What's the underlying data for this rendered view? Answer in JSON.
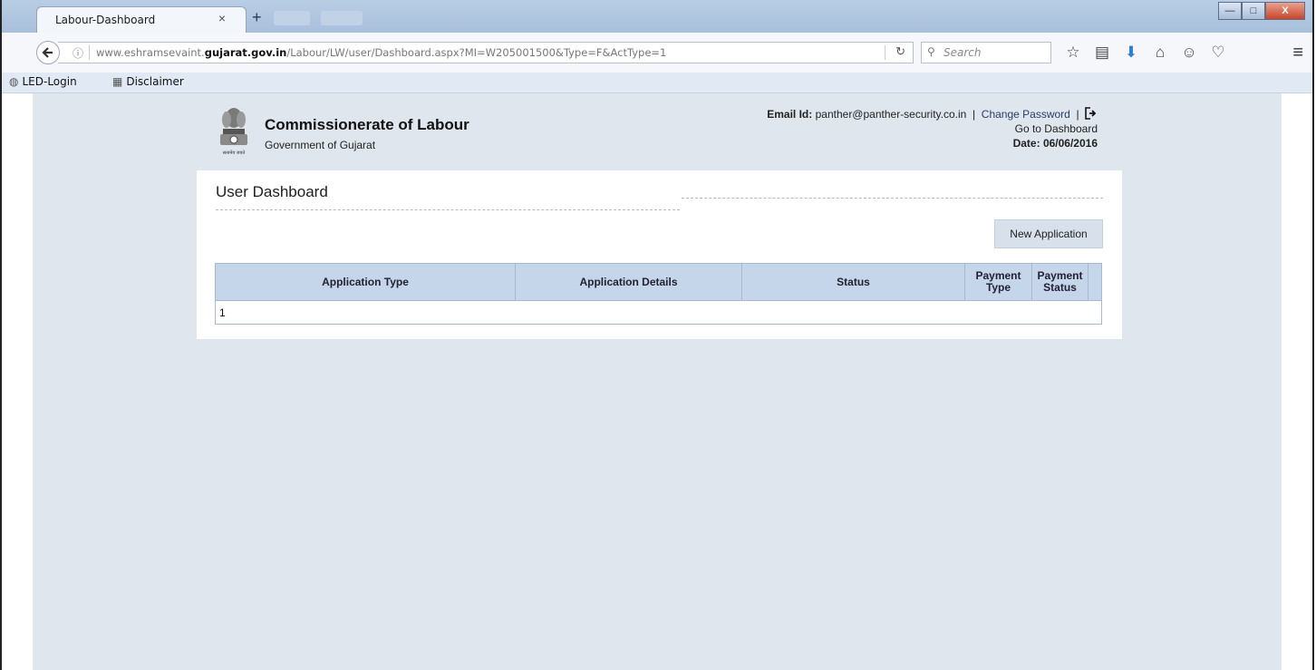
{
  "browser": {
    "tab_title": "Labour-Dashboard",
    "tab_close": "×",
    "new_tab": "+",
    "url_plain_prefix": "www.eshramsevaint.",
    "url_domain": "gujarat.gov.in",
    "url_path": "/Labour/LW/user/Dashboard.aspx?MI=W205001500&Type=F&ActType=1",
    "search_placeholder": "Search",
    "window_minimize": "—",
    "window_maximize": "□",
    "window_close": "X"
  },
  "bookmarks": [
    {
      "label": "LED-Login"
    },
    {
      "label": "Disclaimer"
    }
  ],
  "header": {
    "org_title": "Commissionerate of Labour",
    "org_subtitle": "Government of Gujarat",
    "email_label": "Email Id:",
    "email_value": "panther@panther-security.co.in",
    "separator": "|",
    "change_password": "Change Password",
    "go_to_dashboard": "Go to Dashboard",
    "date_label": "Date:",
    "date_value": "06/06/2016",
    "emblem_caption": "सत्यमेव जयते"
  },
  "dashboard": {
    "title": "User Dashboard",
    "new_application_label": "New Application",
    "columns": [
      "Application Type",
      "Application Details",
      "Status",
      "Payment Type",
      "Payment Status"
    ],
    "rows": [
      {
        "cell": "1"
      }
    ]
  }
}
